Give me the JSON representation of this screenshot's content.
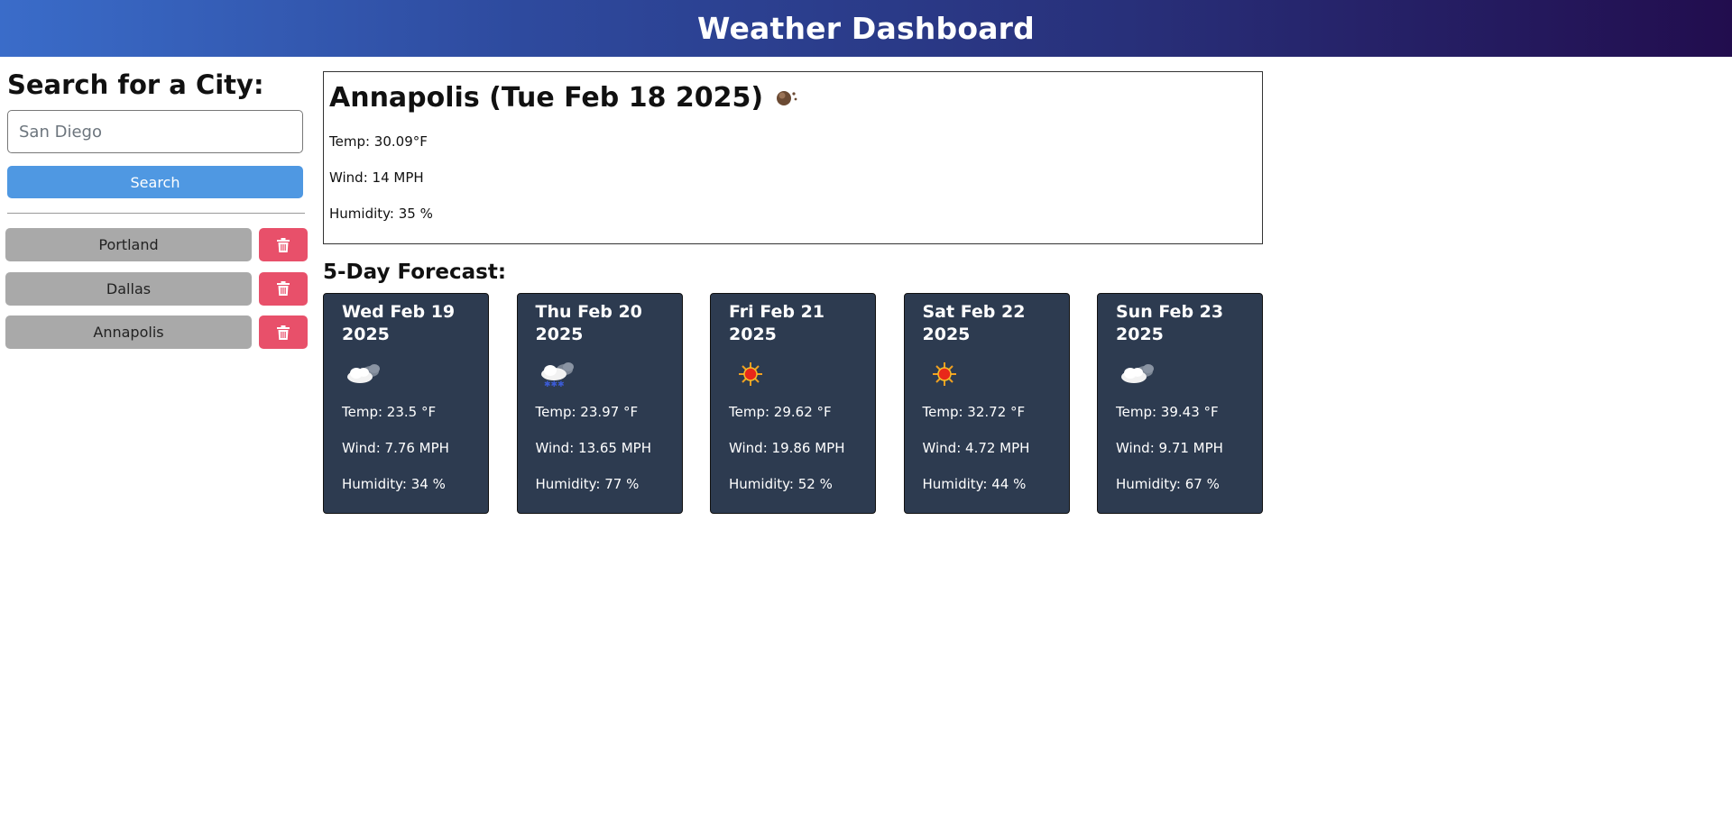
{
  "header": {
    "title": "Weather Dashboard"
  },
  "sidebar": {
    "heading": "Search for a City:",
    "search": {
      "placeholder": "San Diego",
      "value": ""
    },
    "search_button_label": "Search",
    "history": [
      {
        "city": "Portland"
      },
      {
        "city": "Dallas"
      },
      {
        "city": "Annapolis"
      }
    ],
    "delete_icon": "trash-icon"
  },
  "current": {
    "title": "Annapolis (Tue Feb 18 2025)",
    "icon": "haze-icon",
    "temp": "Temp: 30.09°F",
    "wind": "Wind: 14 MPH",
    "humidity": "Humidity: 35 %"
  },
  "forecast": {
    "heading": "5-Day Forecast:",
    "days": [
      {
        "date": "Wed Feb 19 2025",
        "icon": "cloudy-icon",
        "temp": "Temp: 23.5 °F",
        "wind": "Wind: 7.76 MPH",
        "humidity": "Humidity: 34 %"
      },
      {
        "date": "Thu Feb 20 2025",
        "icon": "snow-icon",
        "temp": "Temp: 23.97 °F",
        "wind": "Wind: 13.65 MPH",
        "humidity": "Humidity: 77 %"
      },
      {
        "date": "Fri Feb 21 2025",
        "icon": "sun-icon",
        "temp": "Temp: 29.62 °F",
        "wind": "Wind: 19.86 MPH",
        "humidity": "Humidity: 52 %"
      },
      {
        "date": "Sat Feb 22 2025",
        "icon": "sun-icon",
        "temp": "Temp: 32.72 °F",
        "wind": "Wind: 4.72 MPH",
        "humidity": "Humidity: 44 %"
      },
      {
        "date": "Sun Feb 23 2025",
        "icon": "cloudy-icon",
        "temp": "Temp: 39.43 °F",
        "wind": "Wind: 9.71 MPH",
        "humidity": "Humidity: 67 %"
      }
    ]
  },
  "colors": {
    "search_button": "#4f98e2",
    "delete_button": "#e8506a",
    "history_button": "#a9a9a9",
    "forecast_card": "#2d3b50"
  }
}
